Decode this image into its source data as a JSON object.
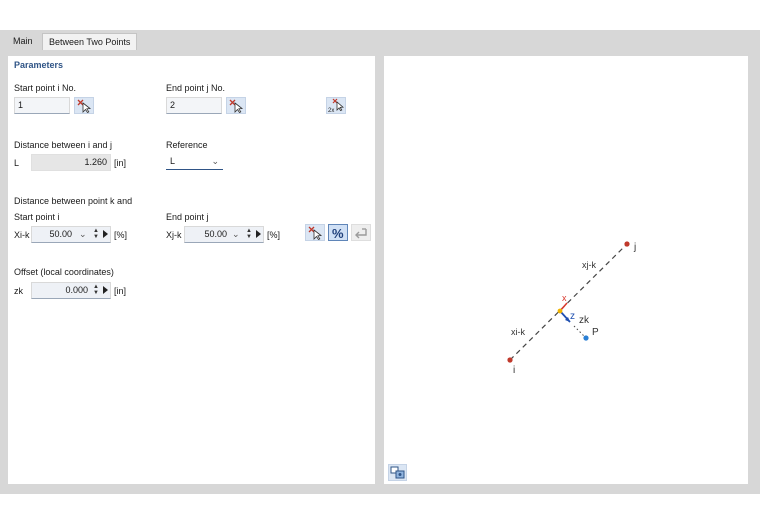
{
  "tabs": [
    {
      "label": "Main"
    },
    {
      "label": "Between Two Points"
    }
  ],
  "parameters": {
    "title": "Parameters",
    "start_point_label": "Start point i No.",
    "start_point_value": "1",
    "end_point_label": "End point j No.",
    "end_point_value": "2",
    "distance_label": "Distance between i and j",
    "distance_symbol": "L",
    "distance_value": "1.260",
    "distance_unit": "[in]",
    "reference_label": "Reference",
    "reference_value": "L",
    "distance_k_label": "Distance between point k and",
    "start_point_i_label": "Start point i",
    "end_point_j_label": "End point j",
    "xik_symbol": "Xi-k",
    "xik_value": "50.00",
    "xik_unit": "[%]",
    "xjk_symbol": "Xj-k",
    "xjk_value": "50.00",
    "xjk_unit": "[%]",
    "offset_label": "Offset (local coordinates)",
    "zk_symbol": "zk",
    "zk_value": "0.000",
    "zk_unit": "[in]"
  },
  "diagram": {
    "label_j": "j",
    "label_i": "i",
    "label_xjk": "xj-k",
    "label_xik": "xi-k",
    "label_x": "x",
    "label_z": "z",
    "label_zk": "zk",
    "label_p": "P"
  },
  "icons": {
    "pick_start": "pick-cursor-icon",
    "pick_end": "pick-cursor-icon",
    "pick_two": "pick-two-points-icon",
    "pick_k": "pick-cursor-icon",
    "percent": "percent-icon",
    "undo": "undo-arrow-icon",
    "view_options": "view-options-icon"
  },
  "colors": {
    "section_title": "#2f5486",
    "point_red": "#c0392b",
    "point_blue": "#2a7fd4",
    "axis_x": "#d9372b",
    "axis_z": "#1f4fb0",
    "point_k": "#f0b400"
  }
}
